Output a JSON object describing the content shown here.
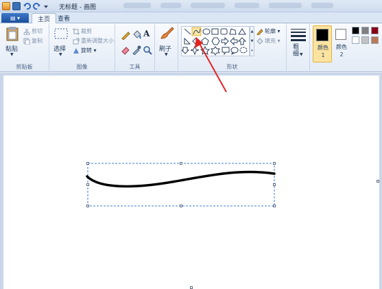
{
  "title": {
    "text": "无标题 - 画图"
  },
  "tabs": [
    {
      "label": "主页"
    },
    {
      "label": "查看"
    }
  ],
  "file_menu": {
    "label": "▤ ▾"
  },
  "clipboard": {
    "paste": "粘贴",
    "cut": "剪切",
    "copy": "复制",
    "group": "剪贴板"
  },
  "image": {
    "select": "选择",
    "crop": "裁剪",
    "resize": "重新调整大小",
    "rotate": "旋转 ▾",
    "group": "图像"
  },
  "tools": {
    "group": "工具",
    "text_glyph": "A"
  },
  "brushes": {
    "label": "刷子"
  },
  "shapes": {
    "outline": "轮廓 ▾",
    "fill": "填充 ▾",
    "group": "形状"
  },
  "size": {
    "label": "粗细"
  },
  "color1": {
    "label": "颜色 1",
    "value": "#000000"
  },
  "color2": {
    "label": "颜色 2",
    "value": "#ffffff"
  },
  "palette": [
    "#000000",
    "#7f7f7f",
    "#880015",
    "#ffffff",
    "#c3c3c3",
    "#b97a57"
  ],
  "accent": "#f6c65b"
}
